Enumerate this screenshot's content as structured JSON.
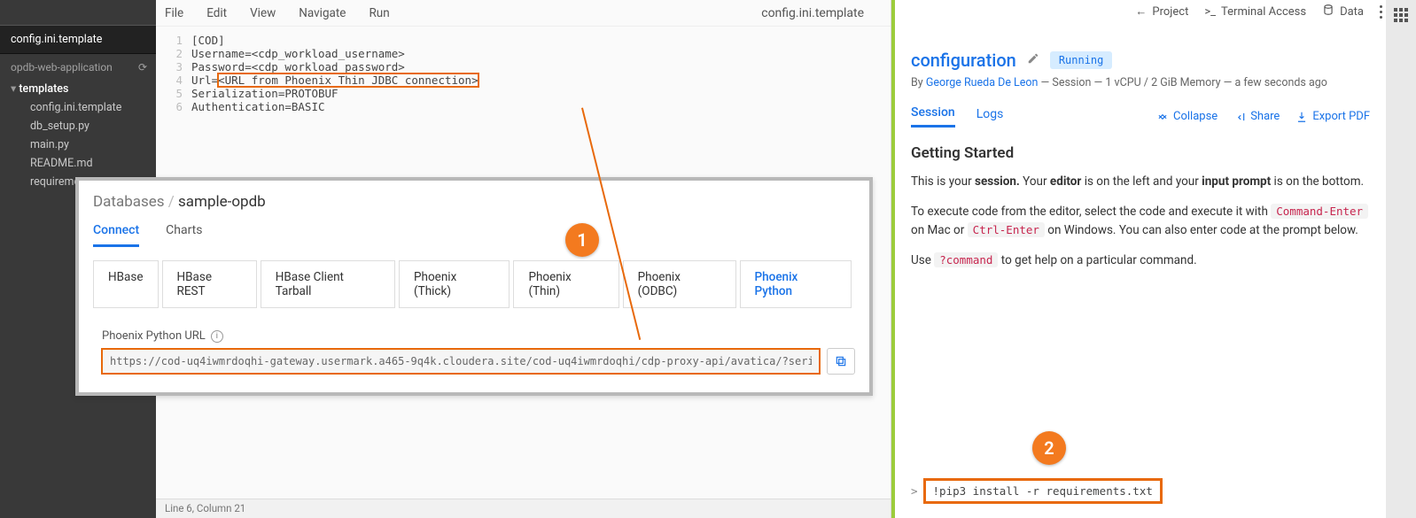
{
  "sidebar": {
    "active_tab": "config.ini.template",
    "project": "opdb-web-application",
    "tree": {
      "folder": "templates",
      "children": [
        "config.ini.template",
        "db_setup.py",
        "main.py",
        "README.md",
        "requirements.txt"
      ]
    }
  },
  "menubar": {
    "items": [
      "File",
      "Edit",
      "View",
      "Navigate",
      "Run"
    ],
    "filename": "config.ini.template"
  },
  "code": {
    "lines": [
      "[COD]",
      "Username=<cdp_workload_username>",
      "Password=<cdp_workload_password>",
      "Url=<URL from Phoenix Thin JDBC connection>",
      "Serialization=PROTOBUF",
      "Authentication=BASIC"
    ],
    "highlight_line_index": 3,
    "highlight_start_char": 4
  },
  "statusbar": {
    "text": "Line 6, Column 21"
  },
  "db_panel": {
    "breadcrumb_root": "Databases",
    "breadcrumb_current": "sample-opdb",
    "tabs": [
      "Connect",
      "Charts"
    ],
    "active_tab": "Connect",
    "subtabs": [
      "HBase",
      "HBase REST",
      "HBase Client Tarball",
      "Phoenix (Thick)",
      "Phoenix (Thin)",
      "Phoenix (ODBC)",
      "Phoenix Python"
    ],
    "active_subtab": "Phoenix Python",
    "field_label": "Phoenix Python URL",
    "url_value": "https://cod-uq4iwmrdoqhi-gateway.usermark.a465-9q4k.cloudera.site/cod-uq4iwmrdoqhi/cdp-proxy-api/avatica/?serialization=PROTOBUF&"
  },
  "annotations": {
    "one": "1",
    "two": "2"
  },
  "session": {
    "toolbar": {
      "project": "Project",
      "terminal": "Terminal Access",
      "data": "Data"
    },
    "title": "configuration",
    "status": "Running",
    "by_prefix": "By ",
    "author": "George Rueda De Leon",
    "meta_rest": " — Session — 1 vCPU / 2 GiB Memory — a few seconds ago",
    "tabs": [
      "Session",
      "Logs"
    ],
    "active_tab": "Session",
    "actions": {
      "collapse": "Collapse",
      "share": "Share",
      "export": "Export PDF"
    },
    "body": {
      "heading": "Getting Started",
      "p1_a": "This is your ",
      "p1_b": "session.",
      "p1_c": " Your ",
      "p1_d": "editor",
      "p1_e": " is on the left and your ",
      "p1_f": "input prompt",
      "p1_g": " is on the bottom.",
      "p2_a": "To execute code from the editor, select the code and execute it with ",
      "p2_code1": "Command-Enter",
      "p2_b": " on Mac or ",
      "p2_code2": "Ctrl-Enter",
      "p2_c": " on Windows. You can also enter code at the prompt below.",
      "p3_a": "Use ",
      "p3_code": "?command",
      "p3_b": " to get help on a particular command."
    },
    "prompt": "!pip3 install -r requirements.txt"
  }
}
